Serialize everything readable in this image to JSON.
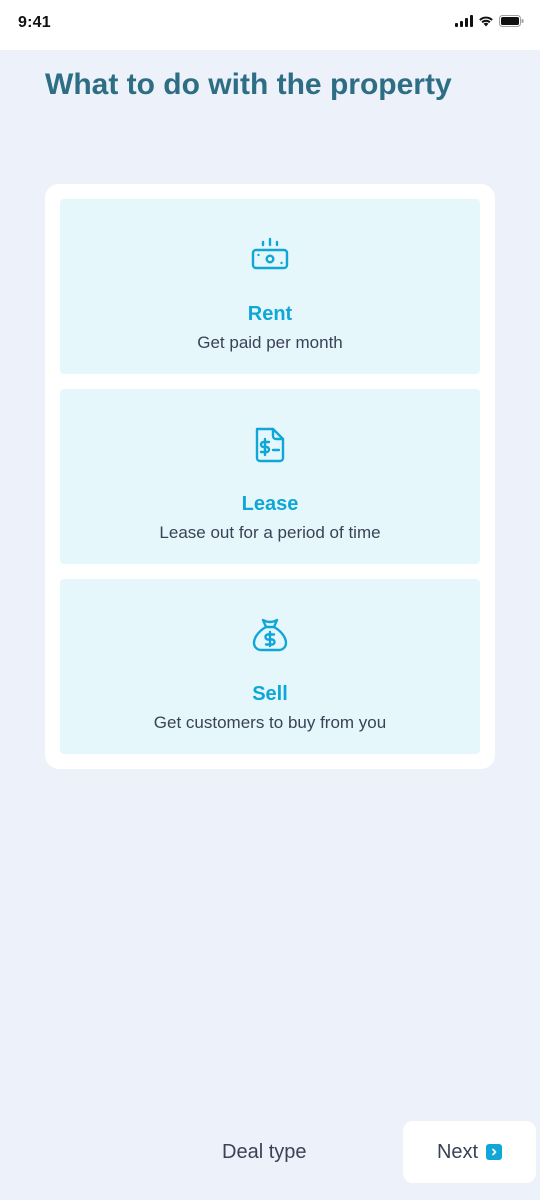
{
  "status_bar": {
    "time": "9:41"
  },
  "page": {
    "title": "What to do with the property"
  },
  "options": [
    {
      "icon": "cash-icon",
      "title": "Rent",
      "description": "Get paid per month"
    },
    {
      "icon": "document-dollar-icon",
      "title": "Lease",
      "description": "Lease out for a period of time"
    },
    {
      "icon": "money-bag-icon",
      "title": "Sell",
      "description": "Get customers to buy from you"
    }
  ],
  "footer": {
    "step_label": "Deal type",
    "next_label": "Next"
  },
  "colors": {
    "background": "#EDF1F9",
    "title": "#2D6E85",
    "accent": "#0FA6D8",
    "option_bg": "#E6F7FC",
    "text": "#3A4255"
  }
}
